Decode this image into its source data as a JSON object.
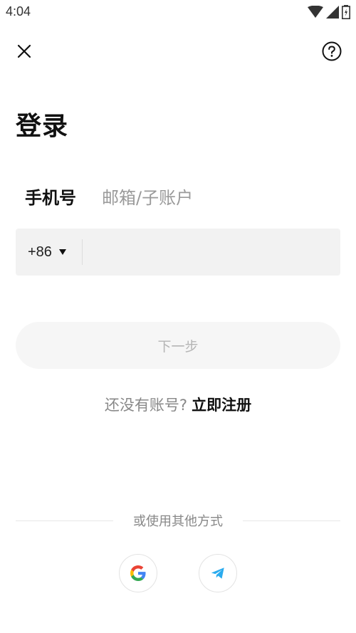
{
  "status_bar": {
    "time": "4:04"
  },
  "header": {
    "close_icon": "close-icon",
    "help_icon": "help-circle-icon"
  },
  "page": {
    "title": "登录"
  },
  "tabs": [
    {
      "label": "手机号",
      "active": true
    },
    {
      "label": "邮箱/子账户",
      "active": false
    }
  ],
  "phone": {
    "country_code": "+86",
    "value": "",
    "placeholder": ""
  },
  "next_button": {
    "label": "下一步"
  },
  "signup": {
    "prompt": "还没有账号?",
    "link": "立即注册"
  },
  "alt_login": {
    "divider_label": "或使用其他方式",
    "providers": [
      "google-icon",
      "telegram-icon"
    ]
  },
  "colors": {
    "background": "#ffffff",
    "input_bg": "#f2f2f2",
    "button_disabled_bg": "#f6f6f6",
    "muted_text": "#888888",
    "google_blue": "#4285F4",
    "google_red": "#EA4335",
    "google_yellow": "#FBBC05",
    "google_green": "#34A853",
    "telegram_blue": "#2AABEE"
  }
}
